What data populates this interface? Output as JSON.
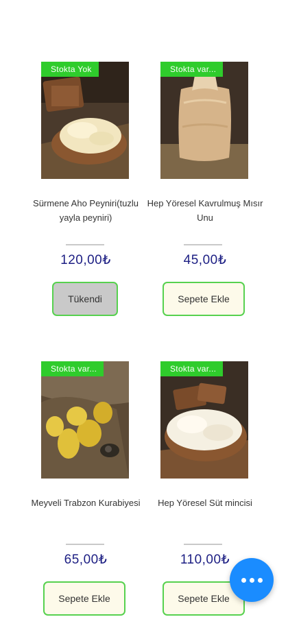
{
  "products": [
    {
      "badge": "Stokta Yok",
      "name": "Sürmene Aho Peyniri(tuzlu yayla peyniri)",
      "price": "120,00₺",
      "button": "Tükendi",
      "image": "crumbly-cheese-on-wood-board"
    },
    {
      "badge": "Stokta var...",
      "name": "Hep Yöresel Kavrulmuş Mısır Unu",
      "price": "45,00₺",
      "button": "Sepete Ekle",
      "image": "corn-flour-in-plastic-bag"
    },
    {
      "badge": "Stokta var...",
      "name": "Meyveli Trabzon Kurabiyesi",
      "price": "65,00₺",
      "button": "Sepete Ekle",
      "image": "yellow-cookies-in-burlap"
    },
    {
      "badge": "Stokta var...",
      "name": "Hep Yöresel Süt mincisi",
      "price": "110,00₺",
      "button": "Sepete Ekle",
      "image": "white-cheese-crumbs-on-board"
    }
  ],
  "fab": {
    "icon": "more-dots-icon"
  },
  "colors": {
    "badge": "#2fcc2c",
    "price": "#1c1e83",
    "button_border": "#56d14e",
    "fab": "#1a8cff"
  }
}
